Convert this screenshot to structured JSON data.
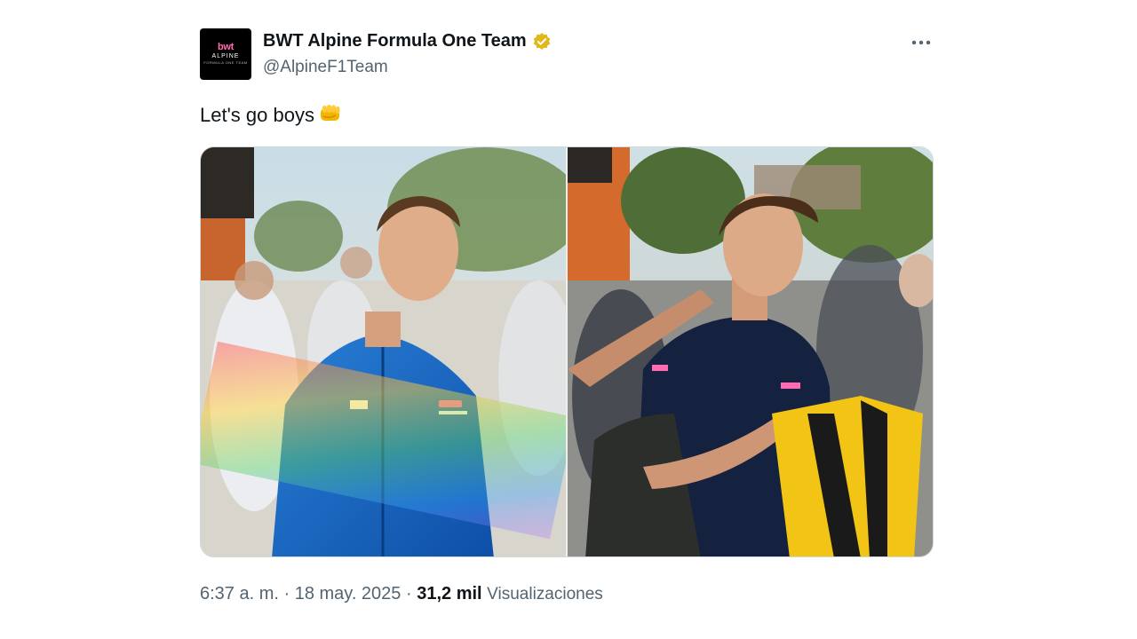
{
  "author": {
    "display_name": "BWT Alpine Formula One Team",
    "handle": "@AlpineF1Team",
    "verified_color": "#e2b719",
    "avatar": {
      "line1": "bwt",
      "line2": "ALPINE",
      "line3": "FORMULA ONE TEAM",
      "icon": "alpine-logo"
    }
  },
  "more_icon": "more-horizontal-icon",
  "tweet": {
    "text": "Let's go boys",
    "emoji": "oncoming-fist"
  },
  "media": {
    "images": [
      {
        "name": "driver-walking-photo",
        "icon": "photo"
      },
      {
        "name": "driver-signing-photo",
        "icon": "photo"
      }
    ]
  },
  "meta": {
    "time": "6:37 a. m.",
    "separator1": " · ",
    "date": "18 may. 2025",
    "separator2": " · ",
    "views_count": "31,2 mil",
    "views_label": "Visualizaciones"
  }
}
